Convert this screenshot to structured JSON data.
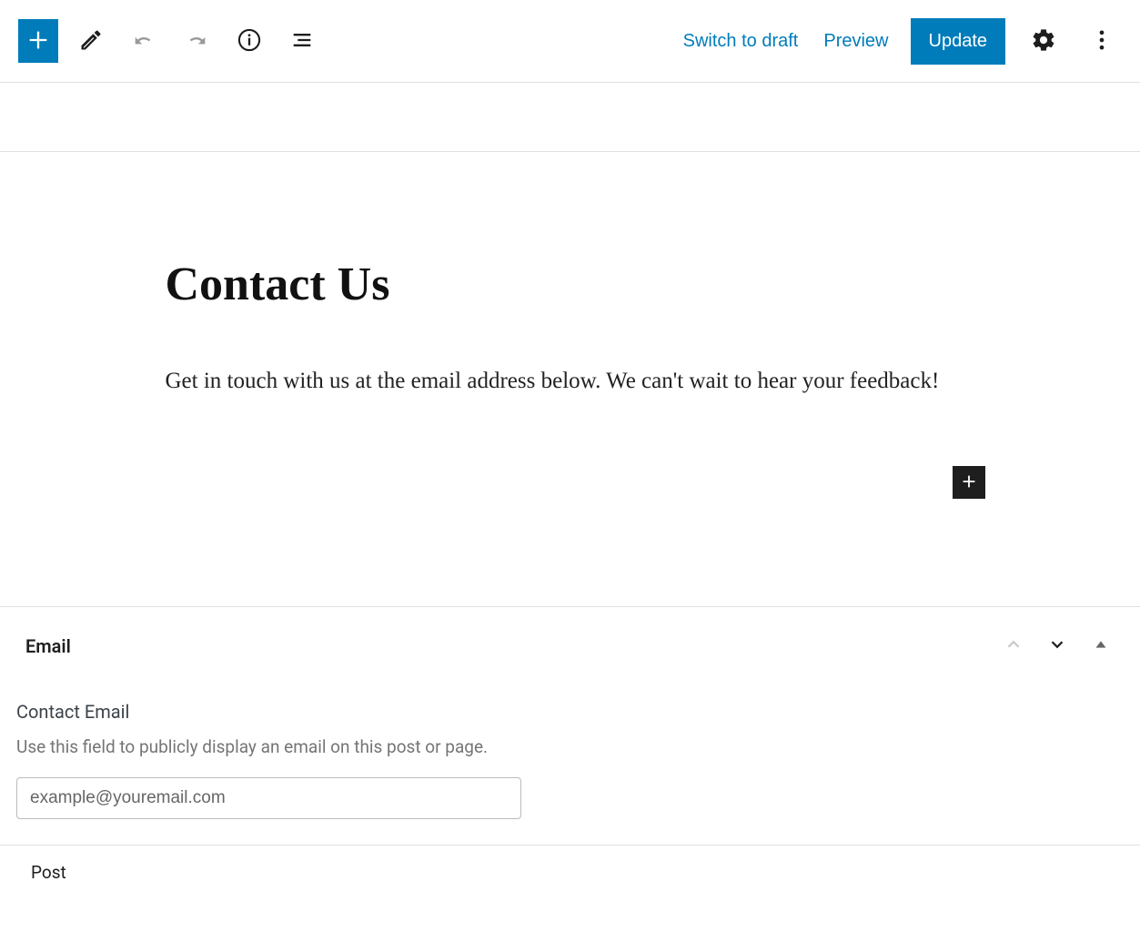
{
  "toolbar": {
    "switch_to_draft": "Switch to draft",
    "preview": "Preview",
    "update": "Update"
  },
  "content": {
    "title": "Contact Us",
    "paragraph": "Get in touch with us at the email address below. We can't wait to hear your feedback!"
  },
  "panel": {
    "section_title": "Email",
    "field_label": "Contact Email",
    "field_description": "Use this field to publicly display an email on this post or page.",
    "email_placeholder": "example@youremail.com"
  },
  "tabs": {
    "post": "Post"
  }
}
